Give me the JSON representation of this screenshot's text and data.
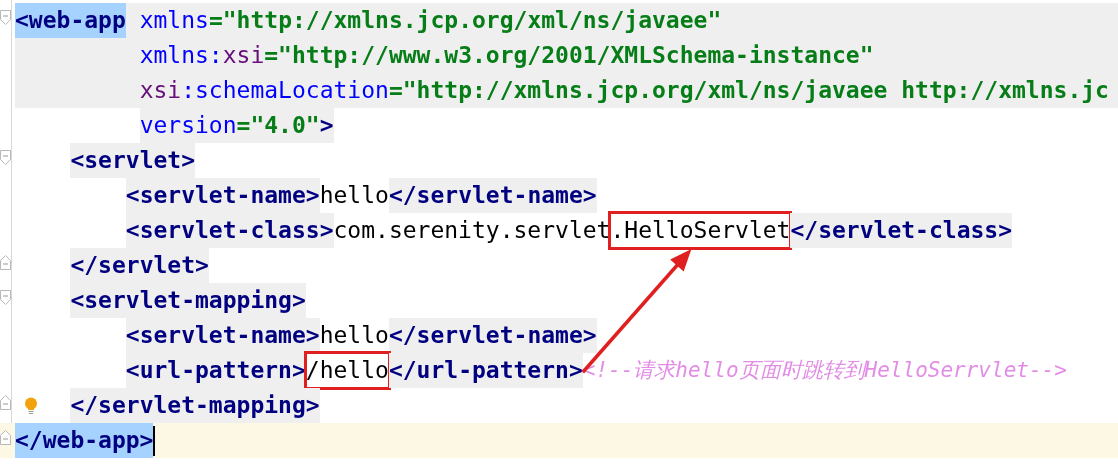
{
  "editor": {
    "annotation_arrow": true,
    "lines": [
      {
        "fold_start": true,
        "shaded": true,
        "tokens": [
          {
            "kind": "tag",
            "text": "<web-app",
            "matched": true
          },
          {
            "kind": "attr",
            "text": " xmlns"
          },
          {
            "kind": "value",
            "text": "=\"http://xmlns.jcp.org/xml/ns/javaee\""
          }
        ]
      },
      {
        "shaded": true,
        "tokens": [
          {
            "kind": "attr",
            "text": "         xmlns:"
          },
          {
            "kind": "ns",
            "text": "xsi"
          },
          {
            "kind": "value",
            "text": "=\"http://www.w3.org/2001/XMLSchema-instance\""
          }
        ]
      },
      {
        "shaded": true,
        "tokens": [
          {
            "kind": "ns",
            "text": "         xsi"
          },
          {
            "kind": "attr",
            "text": ":schemaLocation"
          },
          {
            "kind": "value",
            "text": "=\"http://xmlns.jcp.org/xml/ns/javaee http://xmlns.jc"
          }
        ]
      },
      {
        "tokens": [
          {
            "kind": "attr",
            "text": "         version"
          },
          {
            "kind": "value",
            "text": "=\"4.0\""
          },
          {
            "kind": "tag",
            "text": ">"
          }
        ]
      },
      {
        "fold_start": true,
        "tokens": [
          {
            "kind": "tag",
            "text": "    <servlet>"
          }
        ]
      },
      {
        "tokens": [
          {
            "kind": "tag",
            "text": "        <servlet-name>"
          },
          {
            "kind": "text",
            "text": "hello"
          },
          {
            "kind": "tag",
            "text": "</servlet-name>"
          }
        ]
      },
      {
        "tokens": [
          {
            "kind": "tag",
            "text": "        <servlet-class>"
          },
          {
            "kind": "text",
            "text": "com.serenity.servlet"
          },
          {
            "kind": "text",
            "text": ".HelloServlet",
            "boxed": true
          },
          {
            "kind": "tag",
            "text": "</servlet-class>"
          }
        ]
      },
      {
        "fold_end": true,
        "tokens": [
          {
            "kind": "tag",
            "text": "    </servlet>"
          }
        ]
      },
      {
        "fold_start": true,
        "tokens": [
          {
            "kind": "tag",
            "text": "    <servlet-mapping>"
          }
        ]
      },
      {
        "tokens": [
          {
            "kind": "tag",
            "text": "        <servlet-name>"
          },
          {
            "kind": "text",
            "text": "hello"
          },
          {
            "kind": "tag",
            "text": "</servlet-name>"
          }
        ]
      },
      {
        "tokens": [
          {
            "kind": "tag",
            "text": "        <url-pattern>"
          },
          {
            "kind": "text",
            "text": "/hello",
            "boxed": true
          },
          {
            "kind": "tag",
            "text": "</url-pattern>"
          },
          {
            "kind": "comment",
            "text": "<!--请求hello页面时跳转到HelloSerrvlet-->"
          }
        ]
      },
      {
        "fold_end": true,
        "bulb": true,
        "tokens": [
          {
            "kind": "tag",
            "text": "    </servlet-mapping>"
          }
        ]
      },
      {
        "fold_end": true,
        "current": true,
        "caret": true,
        "tokens": [
          {
            "kind": "tag",
            "text": "</web-app>",
            "matched": true
          }
        ]
      }
    ]
  }
}
